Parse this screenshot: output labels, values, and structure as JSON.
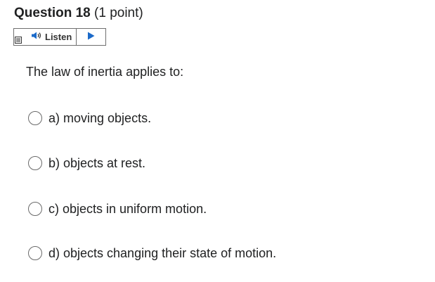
{
  "question": {
    "title": "Question 18",
    "points": "(1 point)",
    "text": "The law of inertia applies to:"
  },
  "listen": {
    "label": "Listen",
    "icons": [
      "menu-icon",
      "speaker-icon",
      "play-icon"
    ],
    "accent_color": "#1b6ac9"
  },
  "options": [
    {
      "label": "a) moving objects."
    },
    {
      "label": "b) objects at rest."
    },
    {
      "label": "c) objects in uniform motion."
    },
    {
      "label": "d) objects changing their state of motion."
    }
  ]
}
